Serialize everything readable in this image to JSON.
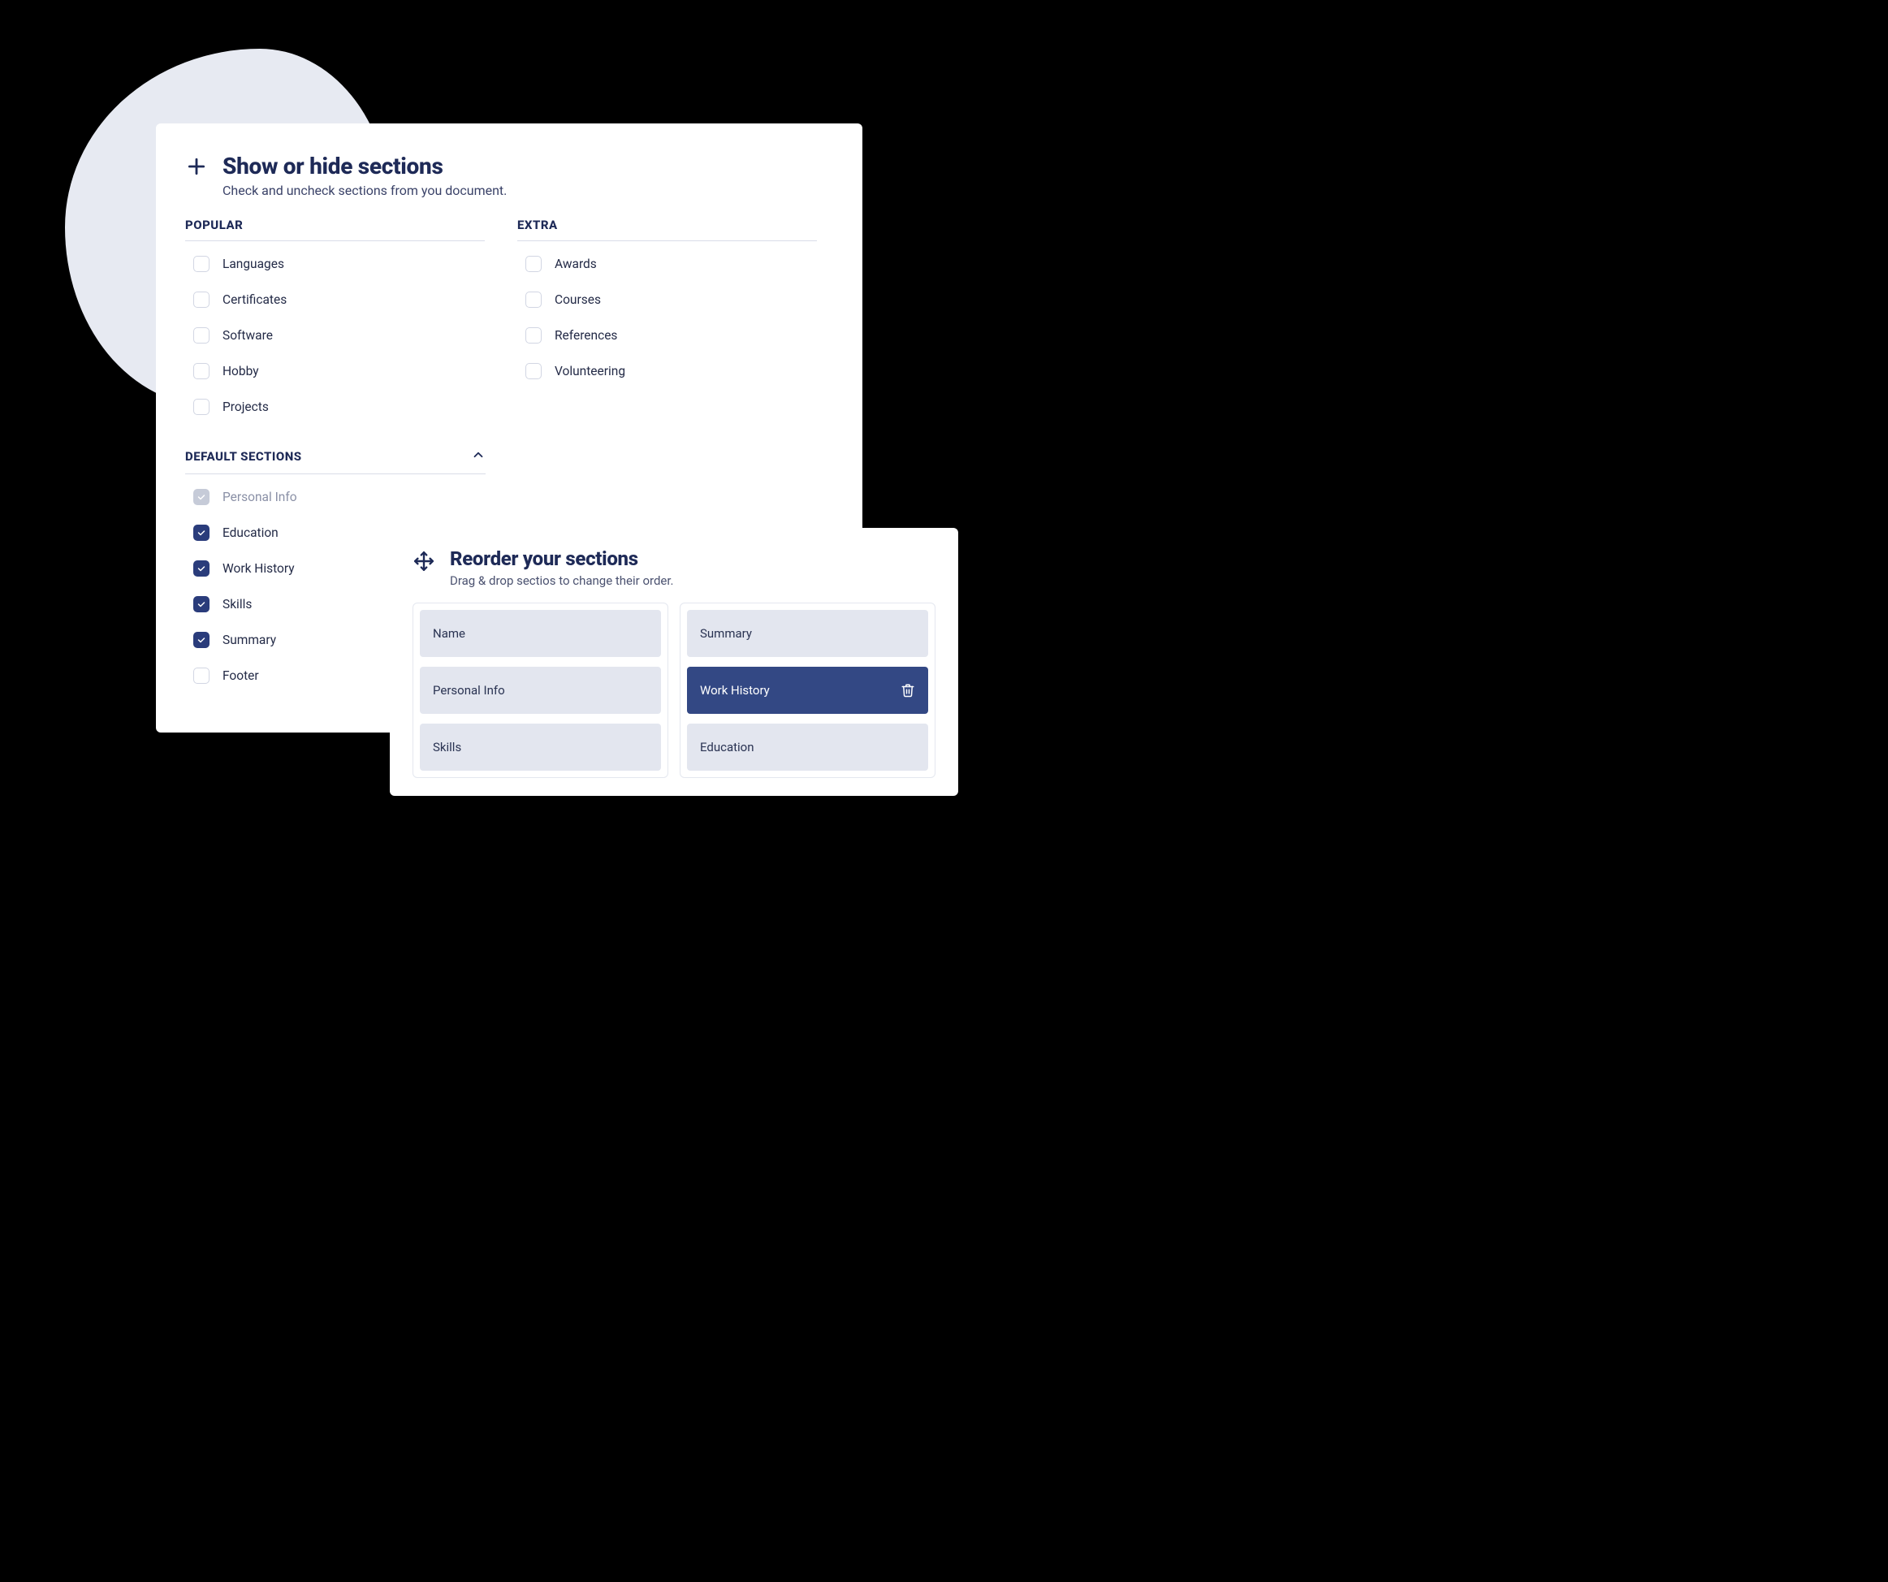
{
  "showHide": {
    "title": "Show or hide sections",
    "subtitle": "Check and uncheck sections from you document.",
    "groups": {
      "popular": {
        "heading": "POPULAR",
        "items": [
          "Languages",
          "Certificates",
          "Software",
          "Hobby",
          "Projects"
        ]
      },
      "extra": {
        "heading": "EXTRA",
        "items": [
          "Awards",
          "Courses",
          "References",
          "Volunteering"
        ]
      },
      "default": {
        "heading": "DEFAULT SECTIONS",
        "items": [
          {
            "label": "Personal Info",
            "state": "locked"
          },
          {
            "label": "Education",
            "state": "checked"
          },
          {
            "label": "Work History",
            "state": "checked"
          },
          {
            "label": "Skills",
            "state": "checked"
          },
          {
            "label": "Summary",
            "state": "checked"
          },
          {
            "label": "Footer",
            "state": "empty"
          }
        ]
      }
    }
  },
  "reorder": {
    "title": "Reorder your sections",
    "subtitle": "Drag & drop sectios to change their order.",
    "columns": [
      [
        "Name",
        "Personal Info",
        "Skills"
      ],
      [
        "Summary",
        "Work History",
        "Education"
      ]
    ],
    "activeItem": "Work History"
  },
  "icons": {
    "plus": "plus-icon",
    "move": "move-icon",
    "chevronUp": "chevron-up-icon",
    "check": "check-icon",
    "trash": "trash-icon"
  },
  "colors": {
    "navy": "#1E2A57",
    "accent": "#2A3C7B",
    "activeTile": "#334884",
    "tile": "#E3E6EF",
    "blob": "#E7EAF2"
  }
}
